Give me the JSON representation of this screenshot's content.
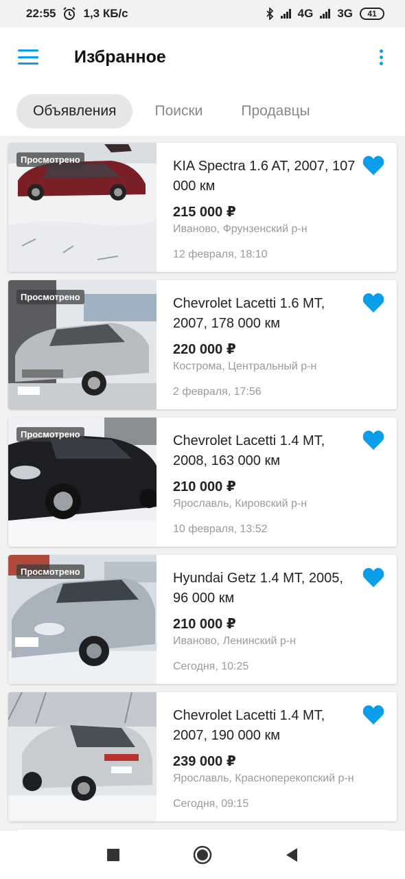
{
  "status": {
    "time": "22:55",
    "speed": "1,3 КБ/с",
    "net1": "4G",
    "net2": "3G",
    "battery": "41"
  },
  "appbar": {
    "title": "Избранное",
    "menu_icon": "hamburger-icon",
    "more_icon": "kebab-icon",
    "accent": "#0a9ee8"
  },
  "tabs": [
    {
      "label": "Объявления",
      "active": true
    },
    {
      "label": "Поиски",
      "active": false
    },
    {
      "label": "Продавцы",
      "active": false
    }
  ],
  "listings": [
    {
      "viewed": "Просмотрено",
      "title": "KIA Spectra 1.6 AT, 2007, 107 000 км",
      "price": "215 000 ₽",
      "location": "Иваново, Фрунзенский р-н",
      "date": "12 февраля, 18:10",
      "favorite": true
    },
    {
      "viewed": "Просмотрено",
      "title": "Chevrolet Lacetti 1.6 MT, 2007, 178 000 км",
      "price": "220 000 ₽",
      "location": "Кострома, Центральный р-н",
      "date": "2 февраля, 17:56",
      "favorite": true
    },
    {
      "viewed": "Просмотрено",
      "title": "Chevrolet Lacetti 1.4 MT, 2008, 163 000 км",
      "price": "210 000 ₽",
      "location": "Ярославль, Кировский р-н",
      "date": "10 февраля, 13:52",
      "favorite": true
    },
    {
      "viewed": "Просмотрено",
      "title": "Hyundai Getz 1.4 MT, 2005, 96 000 км",
      "price": "210 000 ₽",
      "location": "Иваново, Ленинский р-н",
      "date": "Сегодня, 10:25",
      "favorite": true
    },
    {
      "viewed": "",
      "title": "Chevrolet Lacetti 1.4 MT, 2007, 190 000 км",
      "price": "239 000 ₽",
      "location": "Ярославль, Красноперекопский р-н",
      "date": "Сегодня, 09:15",
      "favorite": true
    }
  ],
  "colors": {
    "heart": "#0a9ee8",
    "secondary_text": "#9a9a9a"
  }
}
